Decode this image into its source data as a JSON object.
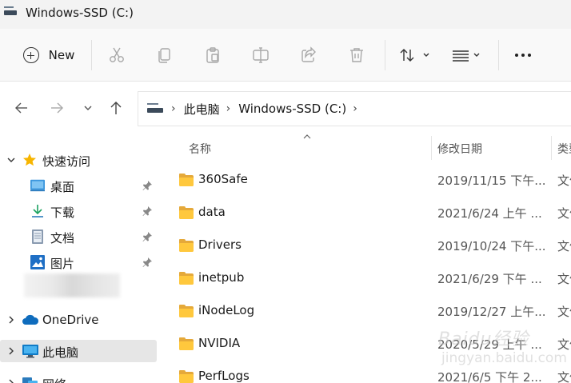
{
  "window": {
    "title": "Windows-SSD (C:)"
  },
  "toolbar": {
    "new_label": "New",
    "icons": [
      "cut-icon",
      "copy-icon",
      "paste-icon",
      "rename-icon",
      "share-icon",
      "delete-icon",
      "sort-icon",
      "view-icon",
      "more-icon"
    ]
  },
  "address": {
    "crumbs": [
      "此电脑",
      "Windows-SSD (C:)"
    ]
  },
  "sidebar": {
    "quick_access": "快速访问",
    "items": [
      {
        "label": "桌面"
      },
      {
        "label": "下载"
      },
      {
        "label": "文档"
      },
      {
        "label": "图片"
      }
    ],
    "onedrive": "OneDrive",
    "this_pc": "此电脑",
    "network": "网络"
  },
  "columns": {
    "name": "名称",
    "modified": "修改日期",
    "type": "类型"
  },
  "files": [
    {
      "name": "360Safe",
      "date": "2019/11/15 下午...",
      "type": "文件夹"
    },
    {
      "name": "data",
      "date": "2021/6/24 上午 ...",
      "type": "文件夹"
    },
    {
      "name": "Drivers",
      "date": "2019/10/24 下午...",
      "type": "文件夹"
    },
    {
      "name": "inetpub",
      "date": "2021/6/29 下午 ...",
      "type": "文件夹"
    },
    {
      "name": "iNodeLog",
      "date": "2019/12/27 上午...",
      "type": "文件夹"
    },
    {
      "name": "NVIDIA",
      "date": "2020/5/29 上午 ...",
      "type": "文件夹"
    },
    {
      "name": "PerfLogs",
      "date": "2021/6/5 下午 2...",
      "type": "文件夹"
    }
  ],
  "watermark": {
    "line1": "Baidu经验",
    "line2": "jingyan.baidu.com"
  },
  "colors": {
    "folder": "#ffc83d",
    "selected": "#e6e6e6",
    "star": "#f7b500",
    "onedrive": "#0f6cbd"
  }
}
